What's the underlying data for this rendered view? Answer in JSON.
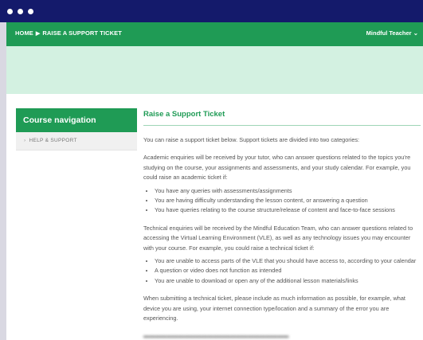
{
  "breadcrumb": {
    "home": "HOME",
    "current": "RAISE A SUPPORT TICKET"
  },
  "user": {
    "name": "Mindful Teacher"
  },
  "sidebar": {
    "heading": "Course navigation",
    "items": [
      {
        "label": "HELP & SUPPORT"
      }
    ]
  },
  "main": {
    "title": "Raise a Support Ticket",
    "intro": "You can raise a support ticket below. Support tickets are divided into two categories:",
    "academic": {
      "text": "Academic enquiries will be received by your tutor, who can answer questions related to the topics you're studying on the course, your assignments and assessments, and your study calendar. For example, you could raise an academic ticket if:",
      "bullets": [
        "You have any queries with assessments/assignments",
        "You are having difficulty understanding the lesson content, or answering a question",
        "You have queries relating to the course structure/release of content and face-to-face sessions"
      ]
    },
    "technical": {
      "text": "Technical enquiries will be received by the Mindful Education Team, who can answer questions related to accessing the Virtual Learning Environment (VLE), as well as any technology issues you may encounter with your course. For example, you could raise a technical ticket if:",
      "bullets": [
        "You are unable to access parts of the VLE that you should have access to, according to your calendar",
        "A question or video does not function as intended",
        "You are unable to download or open any of the additional lesson materials/links"
      ]
    },
    "submitting": "When submitting a technical ticket, please include as much information as possible, for example, what device you are using, your internet connection type/location and a summary of the error you are experiencing."
  },
  "colors": {
    "window_titlebar": "#141a6b",
    "brand_green": "#1f9b55",
    "banner_mint": "#d3f1e1"
  }
}
